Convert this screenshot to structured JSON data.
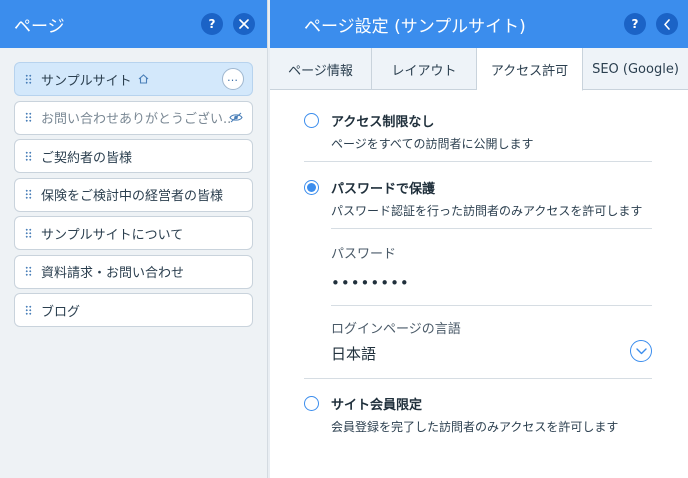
{
  "left_panel": {
    "title": "ページ",
    "help_label": "?",
    "pages": [
      {
        "label": "サンプルサイト",
        "home": true,
        "selected": true,
        "hidden": false,
        "more": "…"
      },
      {
        "label": "お問い合わせありがとうござい..",
        "home": false,
        "selected": false,
        "hidden": true
      },
      {
        "label": "ご契約者の皆様",
        "home": false,
        "selected": false,
        "hidden": false
      },
      {
        "label": "保険をご検討中の経営者の皆様",
        "home": false,
        "selected": false,
        "hidden": false
      },
      {
        "label": "サンプルサイトについて",
        "home": false,
        "selected": false,
        "hidden": false
      },
      {
        "label": "資料請求・お問い合わせ",
        "home": false,
        "selected": false,
        "hidden": false
      },
      {
        "label": "ブログ",
        "home": false,
        "selected": false,
        "hidden": false
      }
    ]
  },
  "right_panel": {
    "title": "ページ設定 (サンプルサイト)",
    "help_label": "?",
    "tabs": [
      {
        "label": "ページ情報",
        "active": false
      },
      {
        "label": "レイアウト",
        "active": false
      },
      {
        "label": "アクセス許可",
        "active": true
      },
      {
        "label": "SEO (Google)",
        "active": false
      }
    ],
    "options": [
      {
        "title": "アクセス制限なし",
        "desc": "ページをすべての訪問者に公開します",
        "checked": false
      },
      {
        "title": "パスワードで保護",
        "desc": "パスワード認証を行った訪問者のみアクセスを許可します",
        "checked": true
      },
      {
        "title": "サイト会員限定",
        "desc": "会員登録を完了した訪問者のみアクセスを許可します",
        "checked": false
      }
    ],
    "password": {
      "label": "パスワード",
      "value": "••••••••"
    },
    "login_language": {
      "label": "ログインページの言語",
      "value": "日本語"
    }
  },
  "colors": {
    "accent": "#3b8ded",
    "accent_dark": "#1b63c6",
    "selected_row": "#d3e8fb"
  },
  "icons": [
    "help-icon",
    "close-icon",
    "back-icon",
    "home-icon",
    "hidden-eye-icon",
    "more-icon",
    "chevron-down-icon",
    "drag-handle-icon"
  ]
}
